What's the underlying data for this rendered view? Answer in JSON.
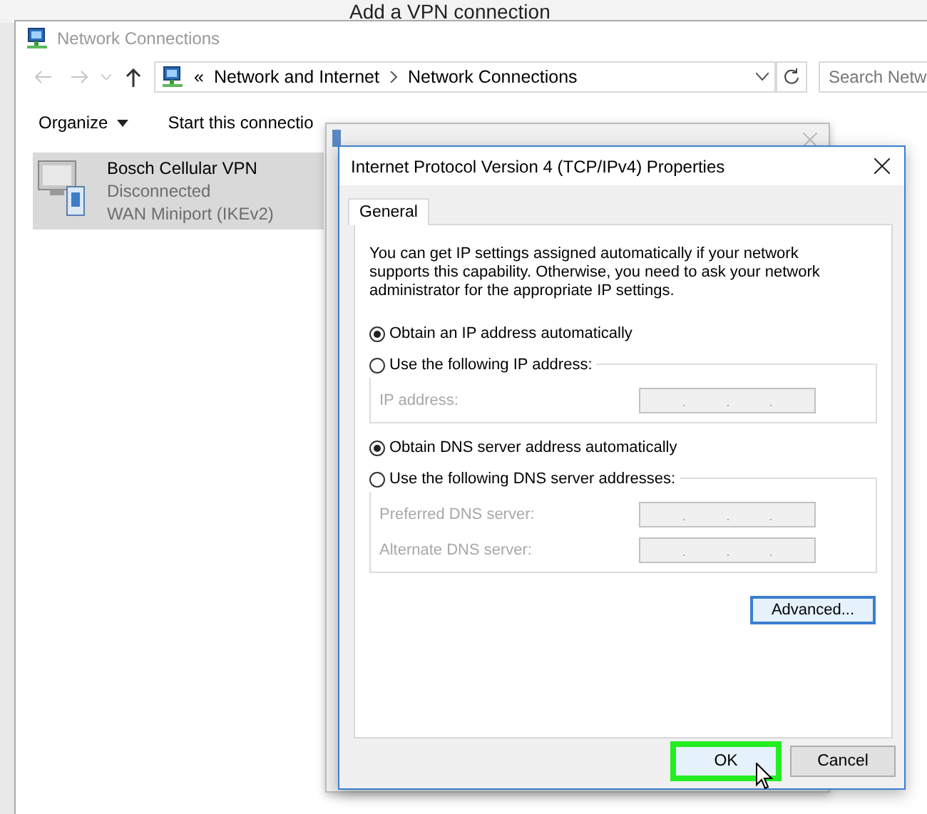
{
  "background_window": {
    "title": "Add a VPN connection"
  },
  "explorer": {
    "title": "Network Connections",
    "overflow": "«",
    "breadcrumb": [
      "Network and Internet",
      "Network Connections"
    ],
    "search": {
      "placeholder": "Search Netw"
    },
    "commands": [
      {
        "label": "Organize",
        "kind": "menu"
      },
      {
        "label": "Start this connectio",
        "kind": "plain"
      }
    ],
    "items": [
      {
        "name": "Bosch Cellular VPN",
        "status": "Disconnected",
        "device": "WAN Miniport (IKEv2)",
        "selected": true
      }
    ]
  },
  "dialog": {
    "title": "Internet Protocol Version 4 (TCP/IPv4) Properties",
    "tabs": [
      {
        "label": "General",
        "selected": true
      }
    ],
    "description": "You can get IP settings assigned automatically if your network supports this capability. Otherwise, you need to ask your network administrator for the appropriate IP settings.",
    "groups": [
      {
        "options": [
          {
            "label": "Obtain an IP address automatically",
            "selected": true
          },
          {
            "label": "Use the following IP address:",
            "selected": false
          }
        ],
        "fields": [
          {
            "label": "IP address:",
            "disabled": true
          }
        ]
      },
      {
        "options": [
          {
            "label": "Obtain DNS server address automatically",
            "selected": true
          },
          {
            "label": "Use the following DNS server addresses:",
            "selected": false
          }
        ],
        "fields": [
          {
            "label": "Preferred DNS server:",
            "disabled": true
          },
          {
            "label": "Alternate DNS server:",
            "disabled": true
          }
        ]
      }
    ],
    "advanced_button": "Advanced...",
    "buttons": [
      {
        "label": "OK",
        "highlighted": true
      },
      {
        "label": "Cancel",
        "highlighted": false
      }
    ]
  }
}
